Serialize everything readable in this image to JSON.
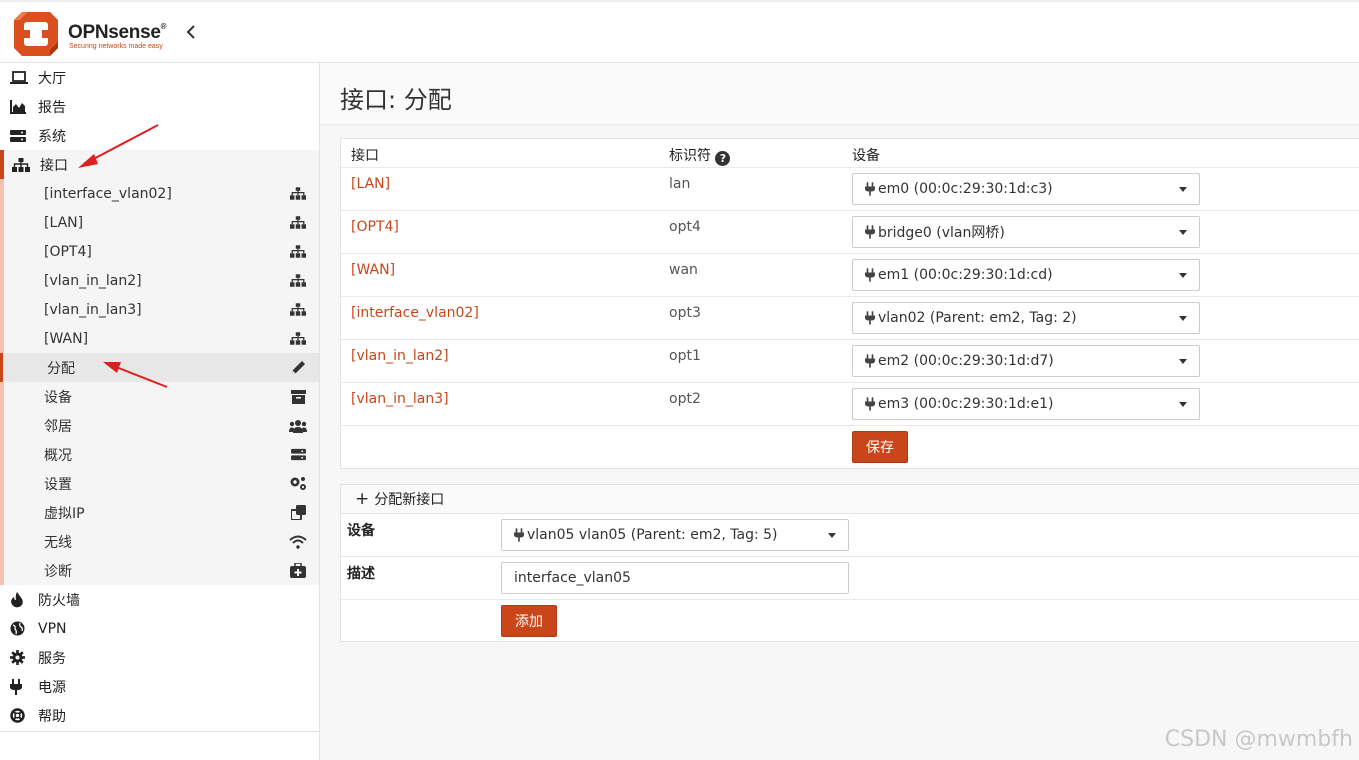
{
  "brand": {
    "name": "OPNsense",
    "registered": "®",
    "tagline": "Securing networks made easy"
  },
  "header": {
    "collapse_icon": "chevron-left-icon"
  },
  "sidebar": {
    "items": [
      {
        "label": "大厅",
        "icon": "laptop-icon"
      },
      {
        "label": "报告",
        "icon": "chart-area-icon"
      },
      {
        "label": "系统",
        "icon": "server-icon"
      },
      {
        "label": "接口",
        "icon": "sitemap-icon"
      },
      {
        "label": "防火墙",
        "icon": "fire-icon"
      },
      {
        "label": "VPN",
        "icon": "globe-icon"
      },
      {
        "label": "服务",
        "icon": "cog-icon"
      },
      {
        "label": "电源",
        "icon": "plug-icon"
      },
      {
        "label": "帮助",
        "icon": "lifebuoy-icon"
      }
    ],
    "interfaces_sub": [
      {
        "label": "[interface_vlan02]",
        "icon": "sitemap-icon"
      },
      {
        "label": "[LAN]",
        "icon": "sitemap-icon"
      },
      {
        "label": "[OPT4]",
        "icon": "sitemap-icon"
      },
      {
        "label": "[vlan_in_lan2]",
        "icon": "sitemap-icon"
      },
      {
        "label": "[vlan_in_lan3]",
        "icon": "sitemap-icon"
      },
      {
        "label": "[WAN]",
        "icon": "sitemap-icon"
      },
      {
        "label": "分配",
        "icon": "pencil-icon"
      },
      {
        "label": "设备",
        "icon": "archive-icon"
      },
      {
        "label": "邻居",
        "icon": "users-icon"
      },
      {
        "label": "概况",
        "icon": "server-icon"
      },
      {
        "label": "设置",
        "icon": "cogs-icon"
      },
      {
        "label": "虚拟IP",
        "icon": "clone-icon"
      },
      {
        "label": "无线",
        "icon": "wifi-icon"
      },
      {
        "label": "诊断",
        "icon": "medkit-icon"
      }
    ]
  },
  "main": {
    "title": "接口: 分配",
    "table": {
      "headers": {
        "interface": "接口",
        "identifier": "标识符",
        "device": "设备"
      },
      "rows": [
        {
          "interface": "[LAN]",
          "identifier": "lan",
          "device": "em0 (00:0c:29:30:1d:c3)"
        },
        {
          "interface": "[OPT4]",
          "identifier": "opt4",
          "device": "bridge0 (vlan网桥)"
        },
        {
          "interface": "[WAN]",
          "identifier": "wan",
          "device": "em1 (00:0c:29:30:1d:cd)"
        },
        {
          "interface": "[interface_vlan02]",
          "identifier": "opt3",
          "device": "vlan02 (Parent: em2, Tag: 2)"
        },
        {
          "interface": "[vlan_in_lan2]",
          "identifier": "opt1",
          "device": "em2 (00:0c:29:30:1d:d7)"
        },
        {
          "interface": "[vlan_in_lan3]",
          "identifier": "opt2",
          "device": "em3 (00:0c:29:30:1d:e1)"
        }
      ],
      "save_label": "保存"
    },
    "assign_new": {
      "header": "分配新接口",
      "device_label": "设备",
      "device_value": "vlan05 vlan05 (Parent: em2, Tag: 5)",
      "description_label": "描述",
      "description_value": "interface_vlan05",
      "add_label": "添加"
    }
  },
  "watermark": "CSDN @mwmbfh",
  "colors": {
    "accent": "#c9461a",
    "accent_light": "#f3c4ad",
    "arrow": "#e02020"
  }
}
